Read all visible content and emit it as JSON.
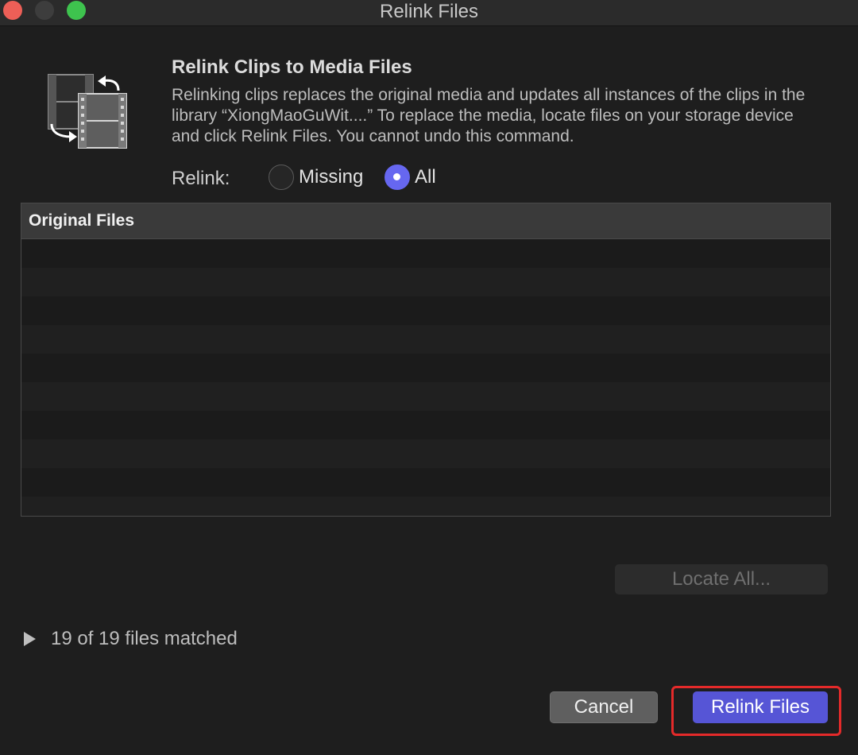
{
  "window": {
    "title": "Relink Files"
  },
  "header": {
    "icon": "relink-film-icon",
    "title": "Relink Clips to Media Files",
    "description": "Relinking clips replaces the original media and updates all instances of the clips in the library “XiongMaoGuWit....” To replace the media, locate files on your storage device and click Relink Files. You cannot undo this command."
  },
  "relink": {
    "label": "Relink:",
    "options": [
      {
        "label": "Missing",
        "selected": false
      },
      {
        "label": "All",
        "selected": true
      }
    ]
  },
  "file_list": {
    "column_header": "Original Files",
    "rows": []
  },
  "buttons": {
    "locate_all": "Locate All...",
    "cancel": "Cancel",
    "relink_files": "Relink Files"
  },
  "status": {
    "matched_text": "19 of 19 files matched"
  },
  "colors": {
    "accent": "#6667f0",
    "primary_button": "#5655d6",
    "highlight": "#e42a2a",
    "background": "#1e1e1e"
  }
}
